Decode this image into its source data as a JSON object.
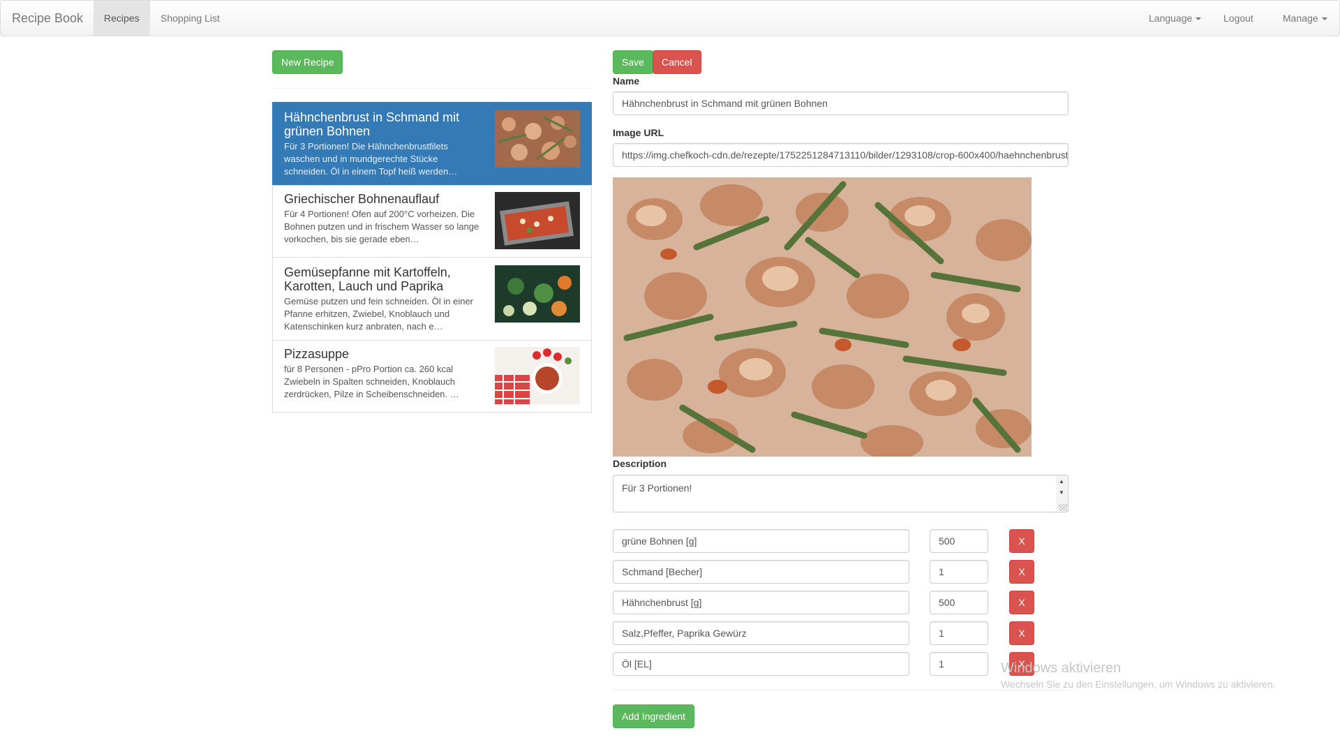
{
  "navbar": {
    "brand": "Recipe Book",
    "recipes": "Recipes",
    "shopping_list": "Shopping List",
    "language": "Language",
    "logout": "Logout",
    "manage": "Manage"
  },
  "list": {
    "new_recipe": "New Recipe",
    "recipes": [
      {
        "title": "Hähnchenbrust in Schmand mit grünen Bohnen",
        "description": "Für 3 Portionen! Die Hähnchenbrustfilets waschen und in mundgerechte Stücke schneiden. Öl in einem Topf heiß werden…",
        "selected": true
      },
      {
        "title": "Griechischer Bohnenauflauf",
        "description": "Für 4 Portionen! Ofen auf 200°C vorheizen. Die Bohnen putzen und in frischem Wasser so lange vorkochen, bis sie gerade eben…",
        "selected": false
      },
      {
        "title": "Gemüsepfanne mit Kartoffeln, Karotten, Lauch und Paprika",
        "description": "Gemüse putzen und fein schneiden. Öl in einer Pfanne erhitzen, Zwiebel, Knoblauch und Katenschinken kurz anbraten, nach e…",
        "selected": false
      },
      {
        "title": "Pizzasuppe",
        "description": "für 8 Personen - pPro Portion ca. 260 kcal Zwiebeln in Spalten schneiden, Knoblauch zerdrücken, Pilze in Scheibenschneiden. …",
        "selected": false
      }
    ]
  },
  "editor": {
    "save": "Save",
    "cancel": "Cancel",
    "name_label": "Name",
    "name_value": "Hähnchenbrust in Schmand mit grünen Bohnen",
    "image_url_label": "Image URL",
    "image_url_value": "https://img.chefkoch-cdn.de/rezepte/1752251284713110/bilder/1293108/crop-600x400/haehnchenbrust",
    "description_label": "Description",
    "description_value": "Für 3 Portionen!",
    "remove_label": "X",
    "ingredients": [
      {
        "name": "grüne Bohnen [g]",
        "amount": "500"
      },
      {
        "name": "Schmand [Becher]",
        "amount": "1"
      },
      {
        "name": "Hähnchenbrust [g]",
        "amount": "500"
      },
      {
        "name": "Salz,Pfeffer, Paprika Gewürz",
        "amount": "1"
      },
      {
        "name": "Öl [EL]",
        "amount": "1"
      }
    ],
    "add_ingredient": "Add Ingredient"
  },
  "watermark": {
    "title": "Windows aktivieren",
    "subtitle": "Wechseln Sie zu den Einstellungen, um Windows zu aktivieren."
  }
}
